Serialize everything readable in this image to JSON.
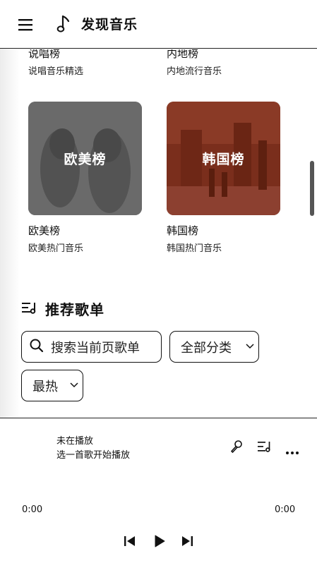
{
  "header": {
    "title": "发现音乐"
  },
  "charts_top": [
    {
      "title": "说唱榜",
      "subtitle": "说唱音乐精选"
    },
    {
      "title": "内地榜",
      "subtitle": "内地流行音乐"
    }
  ],
  "charts": [
    {
      "cover_label": "欧美榜",
      "title": "欧美榜",
      "subtitle": "欧美热门音乐",
      "tint": "#6e6e6e"
    },
    {
      "cover_label": "韩国榜",
      "title": "韩国榜",
      "subtitle": "韩国热门音乐",
      "tint": "#7a2e1c"
    }
  ],
  "playlists": {
    "section_title": "推荐歌单",
    "search_placeholder": "搜索当前页歌单",
    "category_select": "全部分类",
    "sort_select": "最热"
  },
  "player": {
    "status_title": "未在播放",
    "status_subtitle": "选一首歌开始播放",
    "current_time": "0:00",
    "total_time": "0:00"
  },
  "icons": {
    "menu": "menu-icon",
    "note": "music-note-icon",
    "list": "playlist-icon",
    "search": "search-icon",
    "mic": "microphone-icon",
    "more": "more-icon",
    "prev": "previous-icon",
    "play": "play-icon",
    "next": "next-icon"
  }
}
